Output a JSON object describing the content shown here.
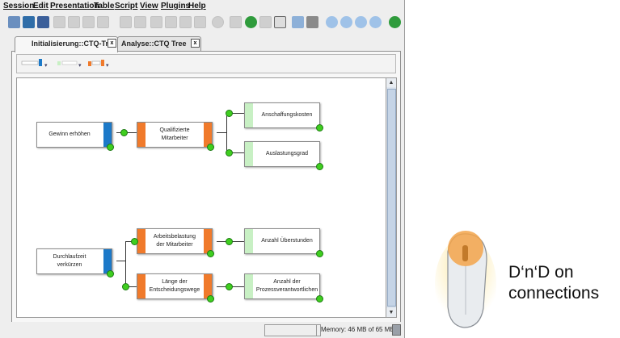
{
  "menubar": [
    "Session",
    "Edit",
    "Presentation",
    "Table",
    "Script",
    "View",
    "Plugins",
    "Help"
  ],
  "tabs": [
    {
      "label": "Initialisierung::CTQ-Tree",
      "close": "x",
      "active": true
    },
    {
      "label": "Analyse::CTQ Tree",
      "close": "x",
      "active": false
    }
  ],
  "tree": {
    "root1": "Gewinn erhöhen",
    "qualified_staff": "Qualifizierte Mitarbeiter",
    "acquisition_cost": "Anschaffungskosten",
    "utilization": "Auslastungsgrad",
    "root2": [
      "Durchlaufzeit",
      "verkürzen"
    ],
    "workload": [
      "Arbeitsbelastung",
      "der Mitarbeiter"
    ],
    "length": [
      "Länge der",
      "Entscheidungswege"
    ],
    "overtime": "Anzahl Überstunden",
    "responsible": [
      "Anzahl der",
      "Prozessverantwortlichen"
    ]
  },
  "statusbar": {
    "memory": "Memory: 46 MB of 65 MB"
  },
  "caption": {
    "line1": "D‘n‘D on",
    "line2": "connections"
  },
  "colors": {
    "root_bar": "#1c79c8",
    "mid_bar": "#f07a2b",
    "leaf_bar": "#c8f0c4",
    "connector": "#3fce1f"
  }
}
